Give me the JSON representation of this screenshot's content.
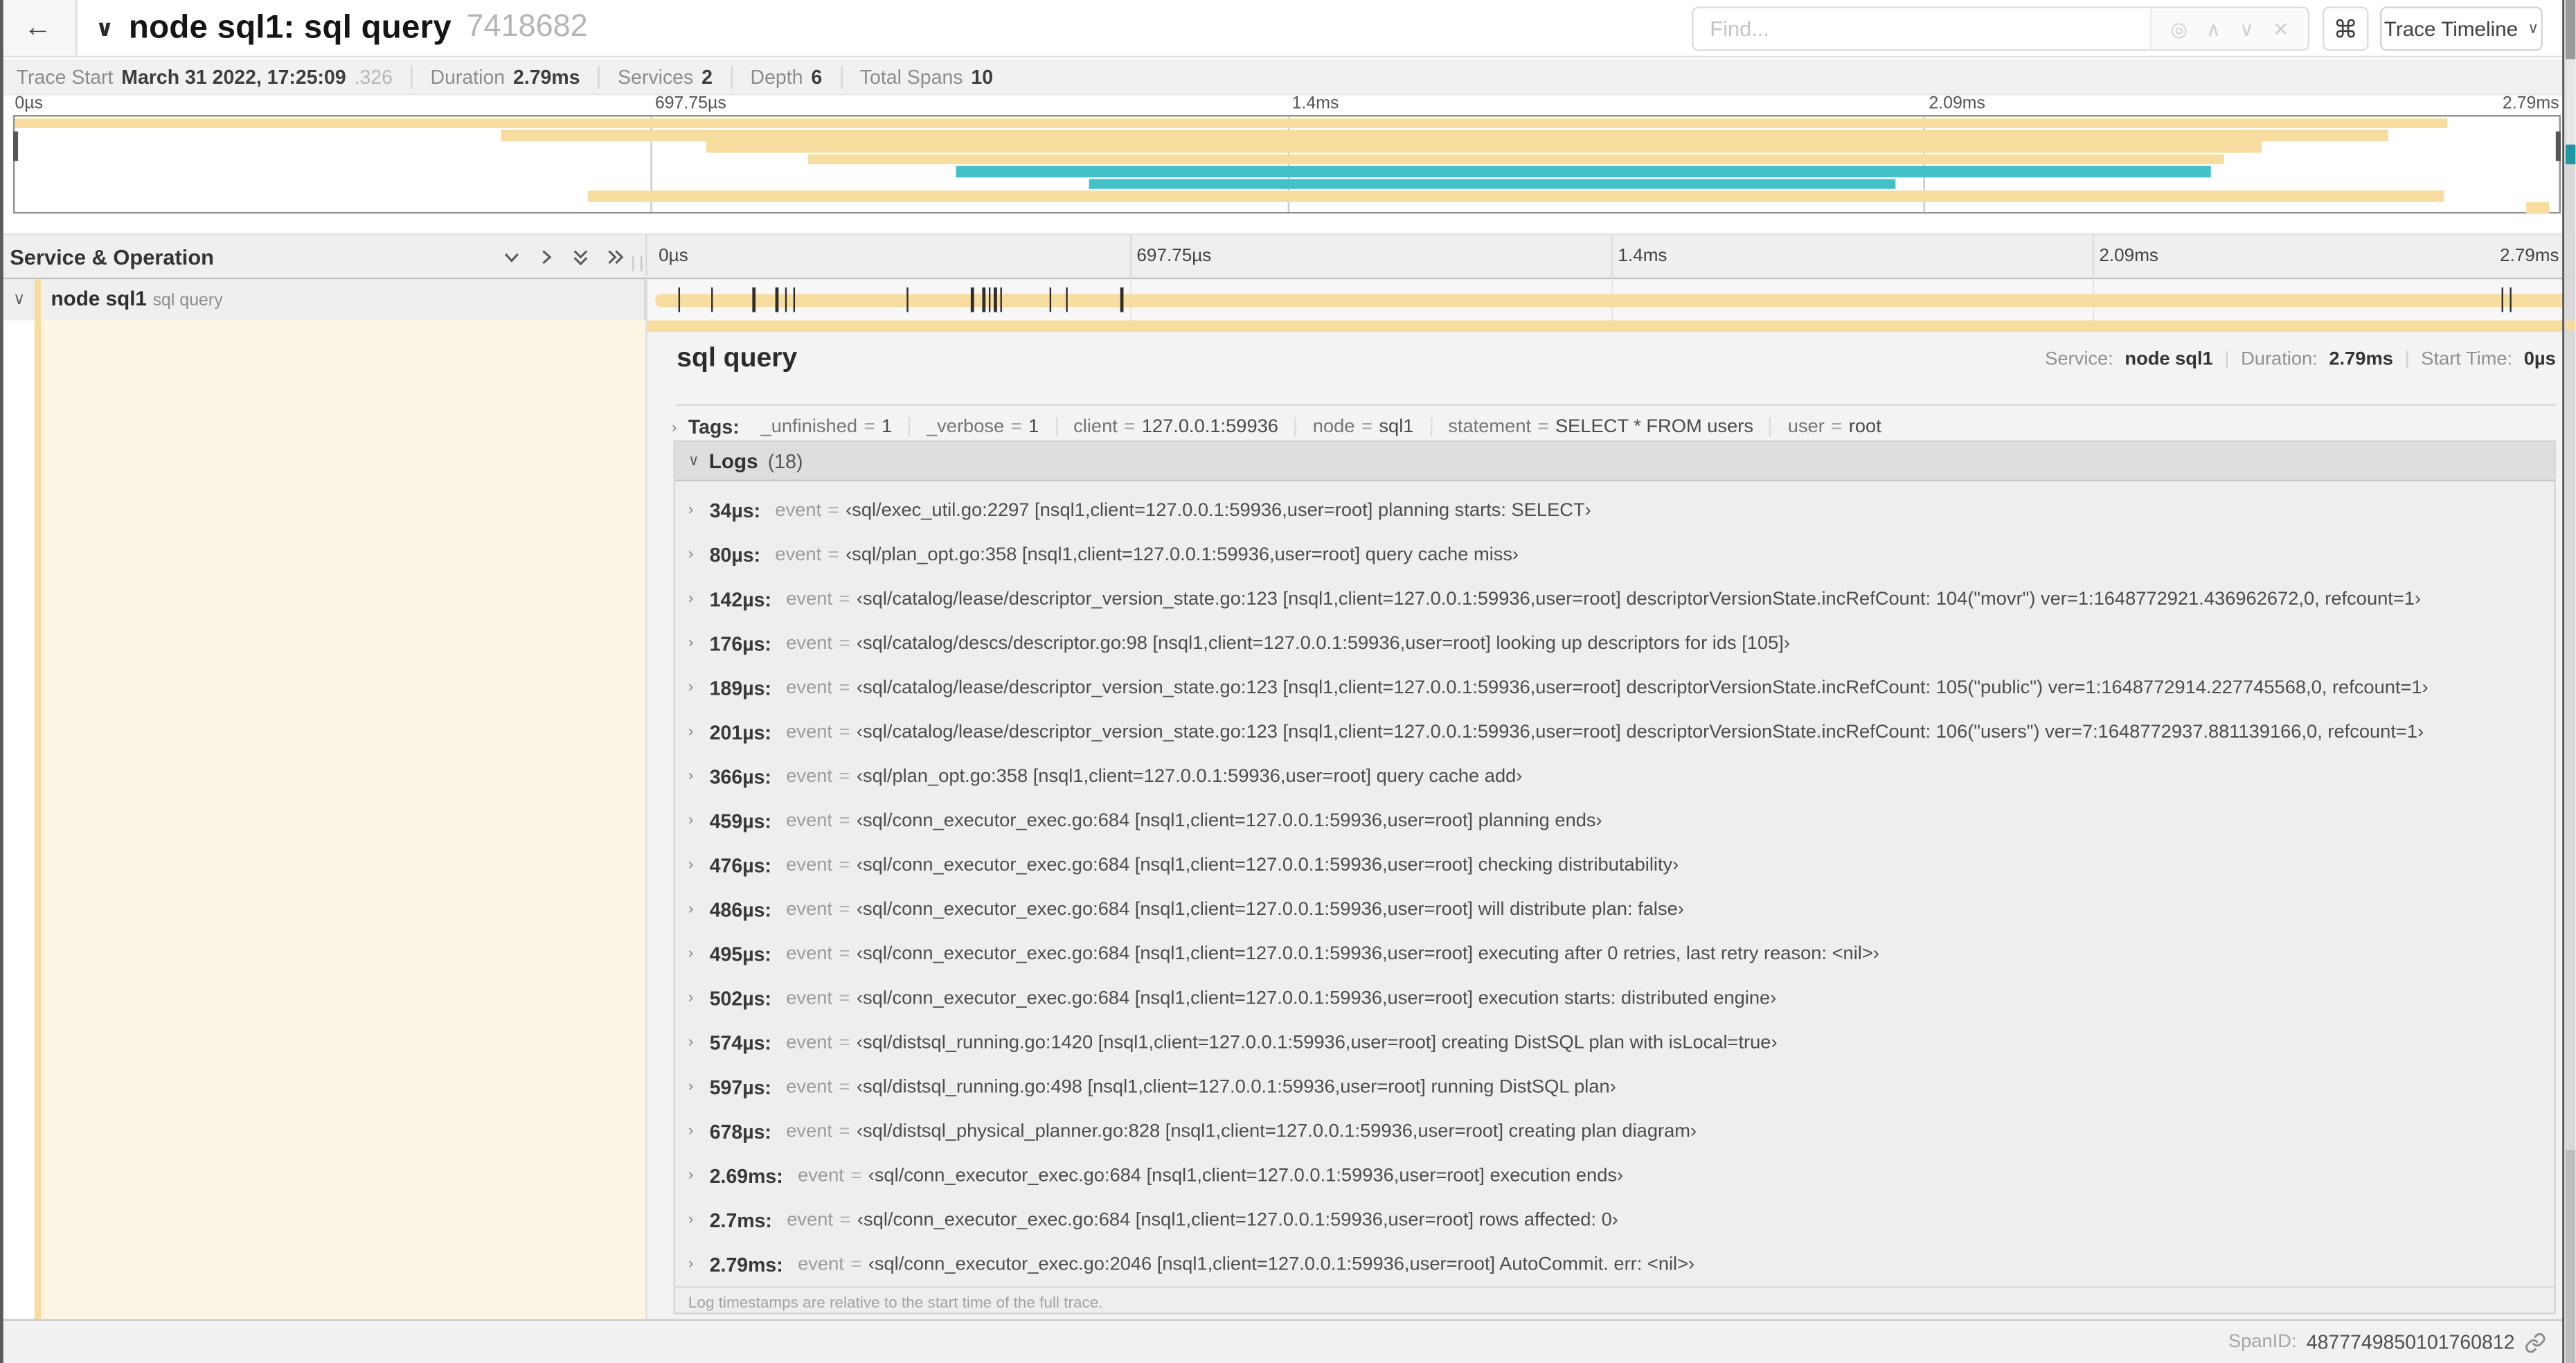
{
  "header": {
    "title": "node sql1: sql query",
    "trace_id": "7418682",
    "find_placeholder": "Find...",
    "view_selector": "Trace Timeline",
    "icons": {
      "back": "←",
      "collapse": "∨",
      "locate": "◎",
      "prev": "∧",
      "next": "∨",
      "clear": "✕",
      "command": "⌘",
      "caret": "∨"
    }
  },
  "stats": {
    "trace_start_label": "Trace Start",
    "trace_start_value": "March 31 2022, 17:25:09",
    "trace_start_fraction": ".326",
    "duration_label": "Duration",
    "duration_value": "2.79ms",
    "services_label": "Services",
    "services_value": "2",
    "depth_label": "Depth",
    "depth_value": "6",
    "total_spans_label": "Total Spans",
    "total_spans_value": "10"
  },
  "minimap": {
    "ticks": [
      "0µs",
      "697.75µs",
      "1.4ms",
      "2.09ms",
      "2.79ms"
    ],
    "bars": [
      {
        "row": 0,
        "start": 0,
        "end": 95.6,
        "color": "tan"
      },
      {
        "row": 1,
        "start": 19.1,
        "end": 93.3,
        "color": "tan"
      },
      {
        "row": 2,
        "start": 27.2,
        "end": 88.3,
        "color": "tan"
      },
      {
        "row": 3,
        "start": 31.2,
        "end": 86.8,
        "color": "tan"
      },
      {
        "row": 4,
        "start": 37.0,
        "end": 86.3,
        "color": "teal"
      },
      {
        "row": 5,
        "start": 42.2,
        "end": 73.9,
        "color": "teal"
      },
      {
        "row": 6,
        "start": 22.5,
        "end": 95.5,
        "color": "tan"
      },
      {
        "row": 7,
        "start": 98.7,
        "end": 99.6,
        "color": "tan"
      }
    ]
  },
  "timeline": {
    "column_header": "Service & Operation",
    "ticks": [
      "0µs",
      "697.75µs",
      "1.4ms",
      "2.09ms",
      "2.79ms"
    ]
  },
  "span_row": {
    "service": "node sql1",
    "operation": "sql query",
    "chevron": "∨",
    "log_marker_positions_pct": [
      1.2,
      2.9,
      5.1,
      6.3,
      6.8,
      7.2,
      13.1,
      16.5,
      17.1,
      17.4,
      17.7,
      18.0,
      20.6,
      21.4,
      24.3,
      96.4,
      96.8
    ]
  },
  "detail": {
    "operation": "sql query",
    "service_label": "Service:",
    "service": "node sql1",
    "duration_label": "Duration:",
    "duration": "2.79ms",
    "start_time_label": "Start Time:",
    "start_time": "0µs",
    "tags_label": "Tags:",
    "tags": [
      {
        "key": "_unfinished",
        "value": "1"
      },
      {
        "key": "_verbose",
        "value": "1"
      },
      {
        "key": "client",
        "value": "127.0.0.1:59936"
      },
      {
        "key": "node",
        "value": "sql1"
      },
      {
        "key": "statement",
        "value": "SELECT * FROM users"
      },
      {
        "key": "user",
        "value": "root"
      }
    ],
    "logs_label": "Logs",
    "logs_count": "(18)",
    "logs": [
      {
        "time": "34µs:",
        "key": "event",
        "value": "‹sql/exec_util.go:2297 [nsql1,client=127.0.0.1:59936,user=root] planning starts: SELECT›"
      },
      {
        "time": "80µs:",
        "key": "event",
        "value": "‹sql/plan_opt.go:358 [nsql1,client=127.0.0.1:59936,user=root] query cache miss›"
      },
      {
        "time": "142µs:",
        "key": "event",
        "value": "‹sql/catalog/lease/descriptor_version_state.go:123 [nsql1,client=127.0.0.1:59936,user=root] descriptorVersionState.incRefCount: 104(\"movr\") ver=1:1648772921.436962672,0, refcount=1›"
      },
      {
        "time": "176µs:",
        "key": "event",
        "value": "‹sql/catalog/descs/descriptor.go:98 [nsql1,client=127.0.0.1:59936,user=root] looking up descriptors for ids [105]›"
      },
      {
        "time": "189µs:",
        "key": "event",
        "value": "‹sql/catalog/lease/descriptor_version_state.go:123 [nsql1,client=127.0.0.1:59936,user=root] descriptorVersionState.incRefCount: 105(\"public\") ver=1:1648772914.227745568,0, refcount=1›"
      },
      {
        "time": "201µs:",
        "key": "event",
        "value": "‹sql/catalog/lease/descriptor_version_state.go:123 [nsql1,client=127.0.0.1:59936,user=root] descriptorVersionState.incRefCount: 106(\"users\") ver=7:1648772937.881139166,0, refcount=1›"
      },
      {
        "time": "366µs:",
        "key": "event",
        "value": "‹sql/plan_opt.go:358 [nsql1,client=127.0.0.1:59936,user=root] query cache add›"
      },
      {
        "time": "459µs:",
        "key": "event",
        "value": "‹sql/conn_executor_exec.go:684 [nsql1,client=127.0.0.1:59936,user=root] planning ends›"
      },
      {
        "time": "476µs:",
        "key": "event",
        "value": "‹sql/conn_executor_exec.go:684 [nsql1,client=127.0.0.1:59936,user=root] checking distributability›"
      },
      {
        "time": "486µs:",
        "key": "event",
        "value": "‹sql/conn_executor_exec.go:684 [nsql1,client=127.0.0.1:59936,user=root] will distribute plan: false›"
      },
      {
        "time": "495µs:",
        "key": "event",
        "value": "‹sql/conn_executor_exec.go:684 [nsql1,client=127.0.0.1:59936,user=root] executing after 0 retries, last retry reason: <nil>›"
      },
      {
        "time": "502µs:",
        "key": "event",
        "value": "‹sql/conn_executor_exec.go:684 [nsql1,client=127.0.0.1:59936,user=root] execution starts: distributed engine›"
      },
      {
        "time": "574µs:",
        "key": "event",
        "value": "‹sql/distsql_running.go:1420 [nsql1,client=127.0.0.1:59936,user=root] creating DistSQL plan with isLocal=true›"
      },
      {
        "time": "597µs:",
        "key": "event",
        "value": "‹sql/distsql_running.go:498 [nsql1,client=127.0.0.1:59936,user=root] running DistSQL plan›"
      },
      {
        "time": "678µs:",
        "key": "event",
        "value": "‹sql/distsql_physical_planner.go:828 [nsql1,client=127.0.0.1:59936,user=root] creating plan diagram›"
      },
      {
        "time": "2.69ms:",
        "key": "event",
        "value": "‹sql/conn_executor_exec.go:684 [nsql1,client=127.0.0.1:59936,user=root] execution ends›"
      },
      {
        "time": "2.7ms:",
        "key": "event",
        "value": "‹sql/conn_executor_exec.go:684 [nsql1,client=127.0.0.1:59936,user=root] rows affected: 0›"
      },
      {
        "time": "2.79ms:",
        "key": "event",
        "value": "‹sql/conn_executor_exec.go:2046 [nsql1,client=127.0.0.1:59936,user=root] AutoCommit. err: <nil>›"
      }
    ],
    "logs_note": "Log timestamps are relative to the start time of the full trace.",
    "spanid_label": "SpanID:",
    "spanid": "4877749850101760812"
  },
  "colors": {
    "span_tan": "#f7dda0",
    "span_teal": "#44c0c8"
  }
}
